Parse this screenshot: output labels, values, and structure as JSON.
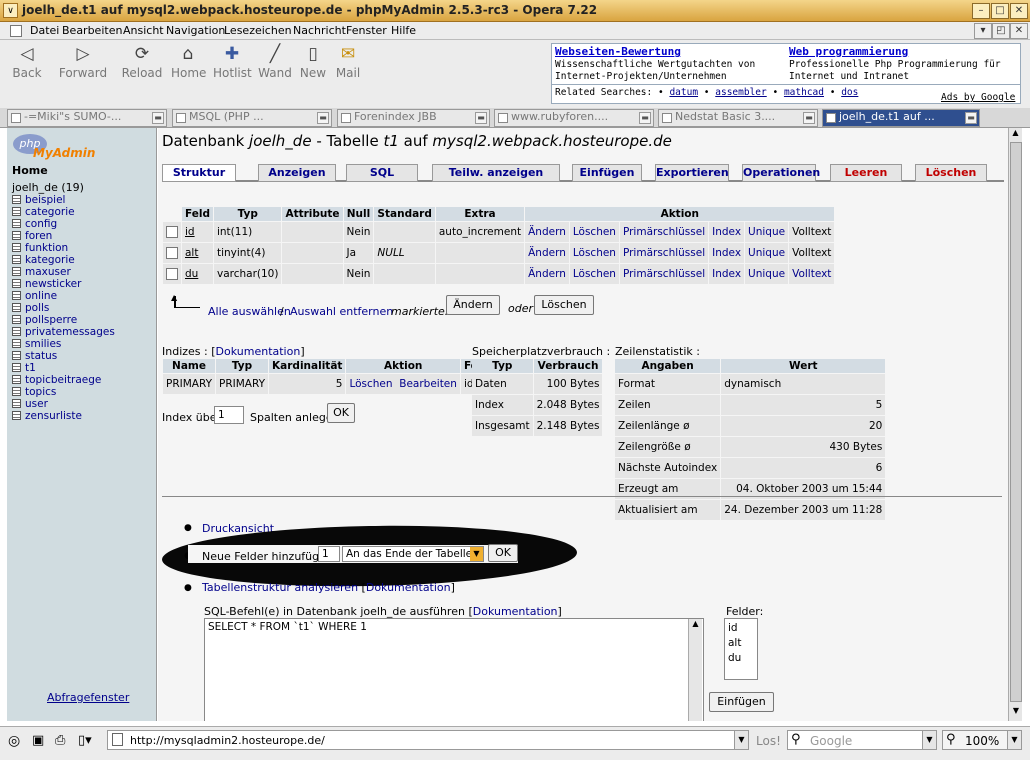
{
  "window": {
    "title": "joelh_de.t1 auf mysql2.webpack.hosteurope.de - phpMyAdmin 2.5.3-rc3 - Opera 7.22"
  },
  "menu": [
    "Datei",
    "Bearbeiten",
    "Ansicht",
    "Navigation",
    "Lesezeichen",
    "Nachricht",
    "Fenster",
    "Hilfe"
  ],
  "toolbar": {
    "back": "Back",
    "forward": "Forward",
    "reload": "Reload",
    "home": "Home",
    "hotlist": "Hotlist",
    "wand": "Wand",
    "new": "New",
    "mail": "Mail"
  },
  "ad": {
    "h1": "Webseiten-Bewertung",
    "t1a": "Wissenschaftliche Wertgutachten von",
    "t1b": "Internet-Projekten/Unternehmen",
    "h2": "Web programmierung",
    "t2a": "Professionelle Php Programmierung für",
    "t2b": "Internet und Intranet",
    "related": "Related Searches:",
    "r1": "datum",
    "r2": "assembler",
    "r3": "mathcad",
    "r4": "dos",
    "ads": "Ads by Google",
    "dot": "•"
  },
  "tabs": [
    "-=Miki\"s SUMO-...",
    "MSQL (PHP ...",
    "Forenindex JBB",
    "www.rubyforen....",
    "Nedstat Basic 3....",
    "joelh_de.t1 auf ..."
  ],
  "sidebar": {
    "logo_php": "php",
    "logo_admin": "MyAdmin",
    "home": "Home",
    "db": "joelh_de (19)",
    "tables": [
      "beispiel",
      "categorie",
      "config",
      "foren",
      "funktion",
      "kategorie",
      "maxuser",
      "newsticker",
      "online",
      "polls",
      "pollsperre",
      "privatemessages",
      "smilies",
      "status",
      "t1",
      "topicbeitraege",
      "topics",
      "user",
      "zensurliste"
    ],
    "query": "Abfragefenster"
  },
  "header": {
    "p1": "Datenbank ",
    "db": "joelh_de",
    "p2": " - Tabelle ",
    "tbl": "t1",
    "p3": " auf ",
    "host": "mysql2.webpack.hosteurope.de"
  },
  "nav": [
    "Struktur",
    "Anzeigen",
    "SQL",
    "Teilw. anzeigen",
    "Einfügen",
    "Exportieren",
    "Operationen",
    "Leeren",
    "Löschen"
  ],
  "fields": {
    "headers": [
      "Feld",
      "Typ",
      "Attribute",
      "Null",
      "Standard",
      "Extra",
      "Aktion"
    ],
    "rows": [
      {
        "feld": "id",
        "typ": "int(11)",
        "attr": "",
        "null": "Nein",
        "std": "",
        "extra": "auto_increment"
      },
      {
        "feld": "alt",
        "typ": "tinyint(4)",
        "attr": "",
        "null": "Ja",
        "std": "NULL",
        "extra": ""
      },
      {
        "feld": "du",
        "typ": "varchar(10)",
        "attr": "",
        "null": "Nein",
        "std": "",
        "extra": ""
      }
    ],
    "actions": [
      "Ändern",
      "Löschen",
      "Primärschlüssel",
      "Index",
      "Unique",
      "Volltext"
    ],
    "select_all": "Alle auswählen",
    "sep": "/",
    "deselect": "Auswahl entfernen",
    "marked": "markierte:",
    "btn_change": "Ändern",
    "oder": "oder",
    "btn_delete": "Löschen"
  },
  "indices": {
    "title": "Indizes : ",
    "doc": "Dokumentation",
    "headers": [
      "Name",
      "Typ",
      "Kardinalität",
      "Aktion",
      "Feld"
    ],
    "row": {
      "name": "PRIMARY",
      "typ": "PRIMARY",
      "card": "5",
      "a1": "Löschen",
      "a2": "Bearbeiten",
      "feld": "id"
    },
    "over": "Index über",
    "cols": "1",
    "cols_label": "Spalten anlegen",
    "ok": "OK"
  },
  "storage": {
    "title": "Speicherplatzverbrauch :",
    "headers": [
      "Typ",
      "Verbrauch"
    ],
    "rows": [
      [
        "Daten",
        "100 Bytes"
      ],
      [
        "Index",
        "2.048 Bytes"
      ],
      [
        "Insgesamt",
        "2.148 Bytes"
      ]
    ]
  },
  "rowstats": {
    "title": "Zeilenstatistik :",
    "headers": [
      "Angaben",
      "Wert"
    ],
    "rows": [
      [
        "Format",
        "dynamisch"
      ],
      [
        "Zeilen",
        "5"
      ],
      [
        "Zeilenlänge ø",
        "20"
      ],
      [
        "Zeilengröße ø",
        "430 Bytes"
      ],
      [
        "Nächste Autoindex",
        "6"
      ],
      [
        "Erzeugt am",
        "04. Oktober 2003 um 15:44"
      ],
      [
        "Aktualisiert am",
        "24. Dezember 2003 um 11:28"
      ]
    ]
  },
  "bottom": {
    "print": "Druckansicht",
    "add_fields": "Neue Felder hinzufügen :",
    "add_count": "1",
    "position": "An das Ende der Tabelle",
    "ok": "OK",
    "analyze": "Tabellenstruktur analysieren",
    "doc": "Dokumentation",
    "sql_label": "SQL-Befehl(e) in Datenbank joelh_de ausführen",
    "sql": "SELECT * FROM `t1` WHERE 1",
    "fields_label": "Felder:",
    "field_list": [
      "id",
      "alt",
      "du"
    ],
    "insert": "Einfügen"
  },
  "status": {
    "url": "http://mysqladmin2.hosteurope.de/",
    "los": "Los!",
    "search": "Google",
    "zoom": "100%"
  }
}
